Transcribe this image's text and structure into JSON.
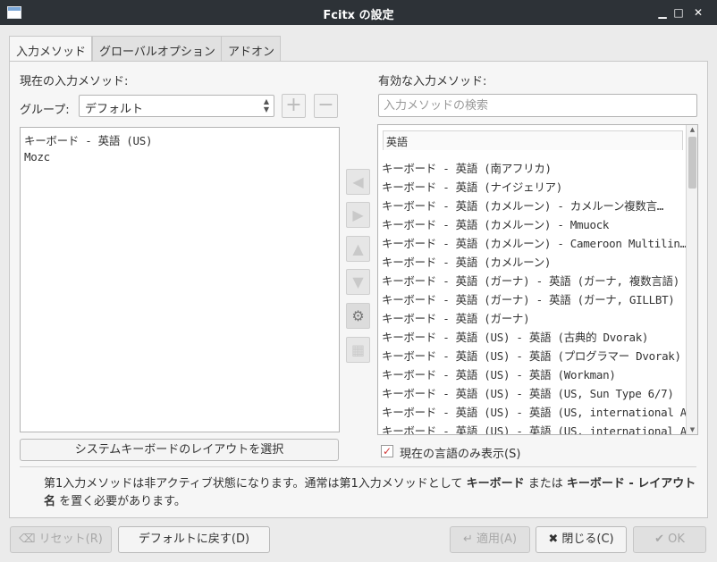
{
  "window": {
    "title": "Fcitx の設定",
    "minimize": "▁",
    "maximize": "□",
    "close": "✕"
  },
  "tabs": [
    {
      "label": "入力メソッド",
      "active": true
    },
    {
      "label": "グローバルオプション",
      "active": false
    },
    {
      "label": "アドオン",
      "active": false
    }
  ],
  "current": {
    "heading": "現在の入力メソッド:",
    "group_label": "グループ:",
    "group_value": "デフォルト",
    "items": [
      "キーボード - 英語 (US)",
      "Mozc"
    ],
    "layout_button": "システムキーボードのレイアウトを選択"
  },
  "available": {
    "heading": "有効な入力メソッド:",
    "search_placeholder": "入力メソッドの検索",
    "section_header": "英語",
    "items": [
      "キーボード - 英語 (南アフリカ)",
      "キーボード - 英語 (ナイジェリア)",
      "キーボード - 英語 (カメルーン) - カメルーン複数言…",
      "キーボード - 英語 (カメルーン) - Mmuock",
      "キーボード - 英語 (カメルーン) - Cameroon Multilin…",
      "キーボード - 英語 (カメルーン)",
      "キーボード - 英語 (ガーナ) - 英語 (ガーナ, 複数言語)",
      "キーボード - 英語 (ガーナ) - 英語 (ガーナ, GILLBT)",
      "キーボード - 英語 (ガーナ)",
      "キーボード - 英語 (US) - 英語 (古典的 Dvorak)",
      "キーボード - 英語 (US) - 英語 (プログラマー Dvorak)",
      "キーボード - 英語 (US) - 英語 (Workman)",
      "キーボード - 英語 (US) - 英語 (US, Sun Type 6/7)",
      "キーボード - 英語 (US) - 英語 (US, international A…",
      "キーボード - 英語 (US) - 英語 (US, international A…"
    ],
    "show_current_lang": "現在の言語のみ表示(S)",
    "show_current_lang_checked": true
  },
  "info": {
    "part1": "第1入力メソッドは非アクティブ状態になります。通常は第1入力メソッドとして ",
    "bold1": "キーボード",
    "part2": " または ",
    "bold2": "キーボード - レイアウト名",
    "part3": " を置く必要があります。"
  },
  "footer": {
    "reset": "リセット(R)",
    "defaults": "デフォルトに戻す(D)",
    "apply": "適用(A)",
    "close": "閉じる(C)",
    "ok": "OK"
  },
  "icons": {
    "add": "plus-icon",
    "remove": "minus-icon"
  }
}
